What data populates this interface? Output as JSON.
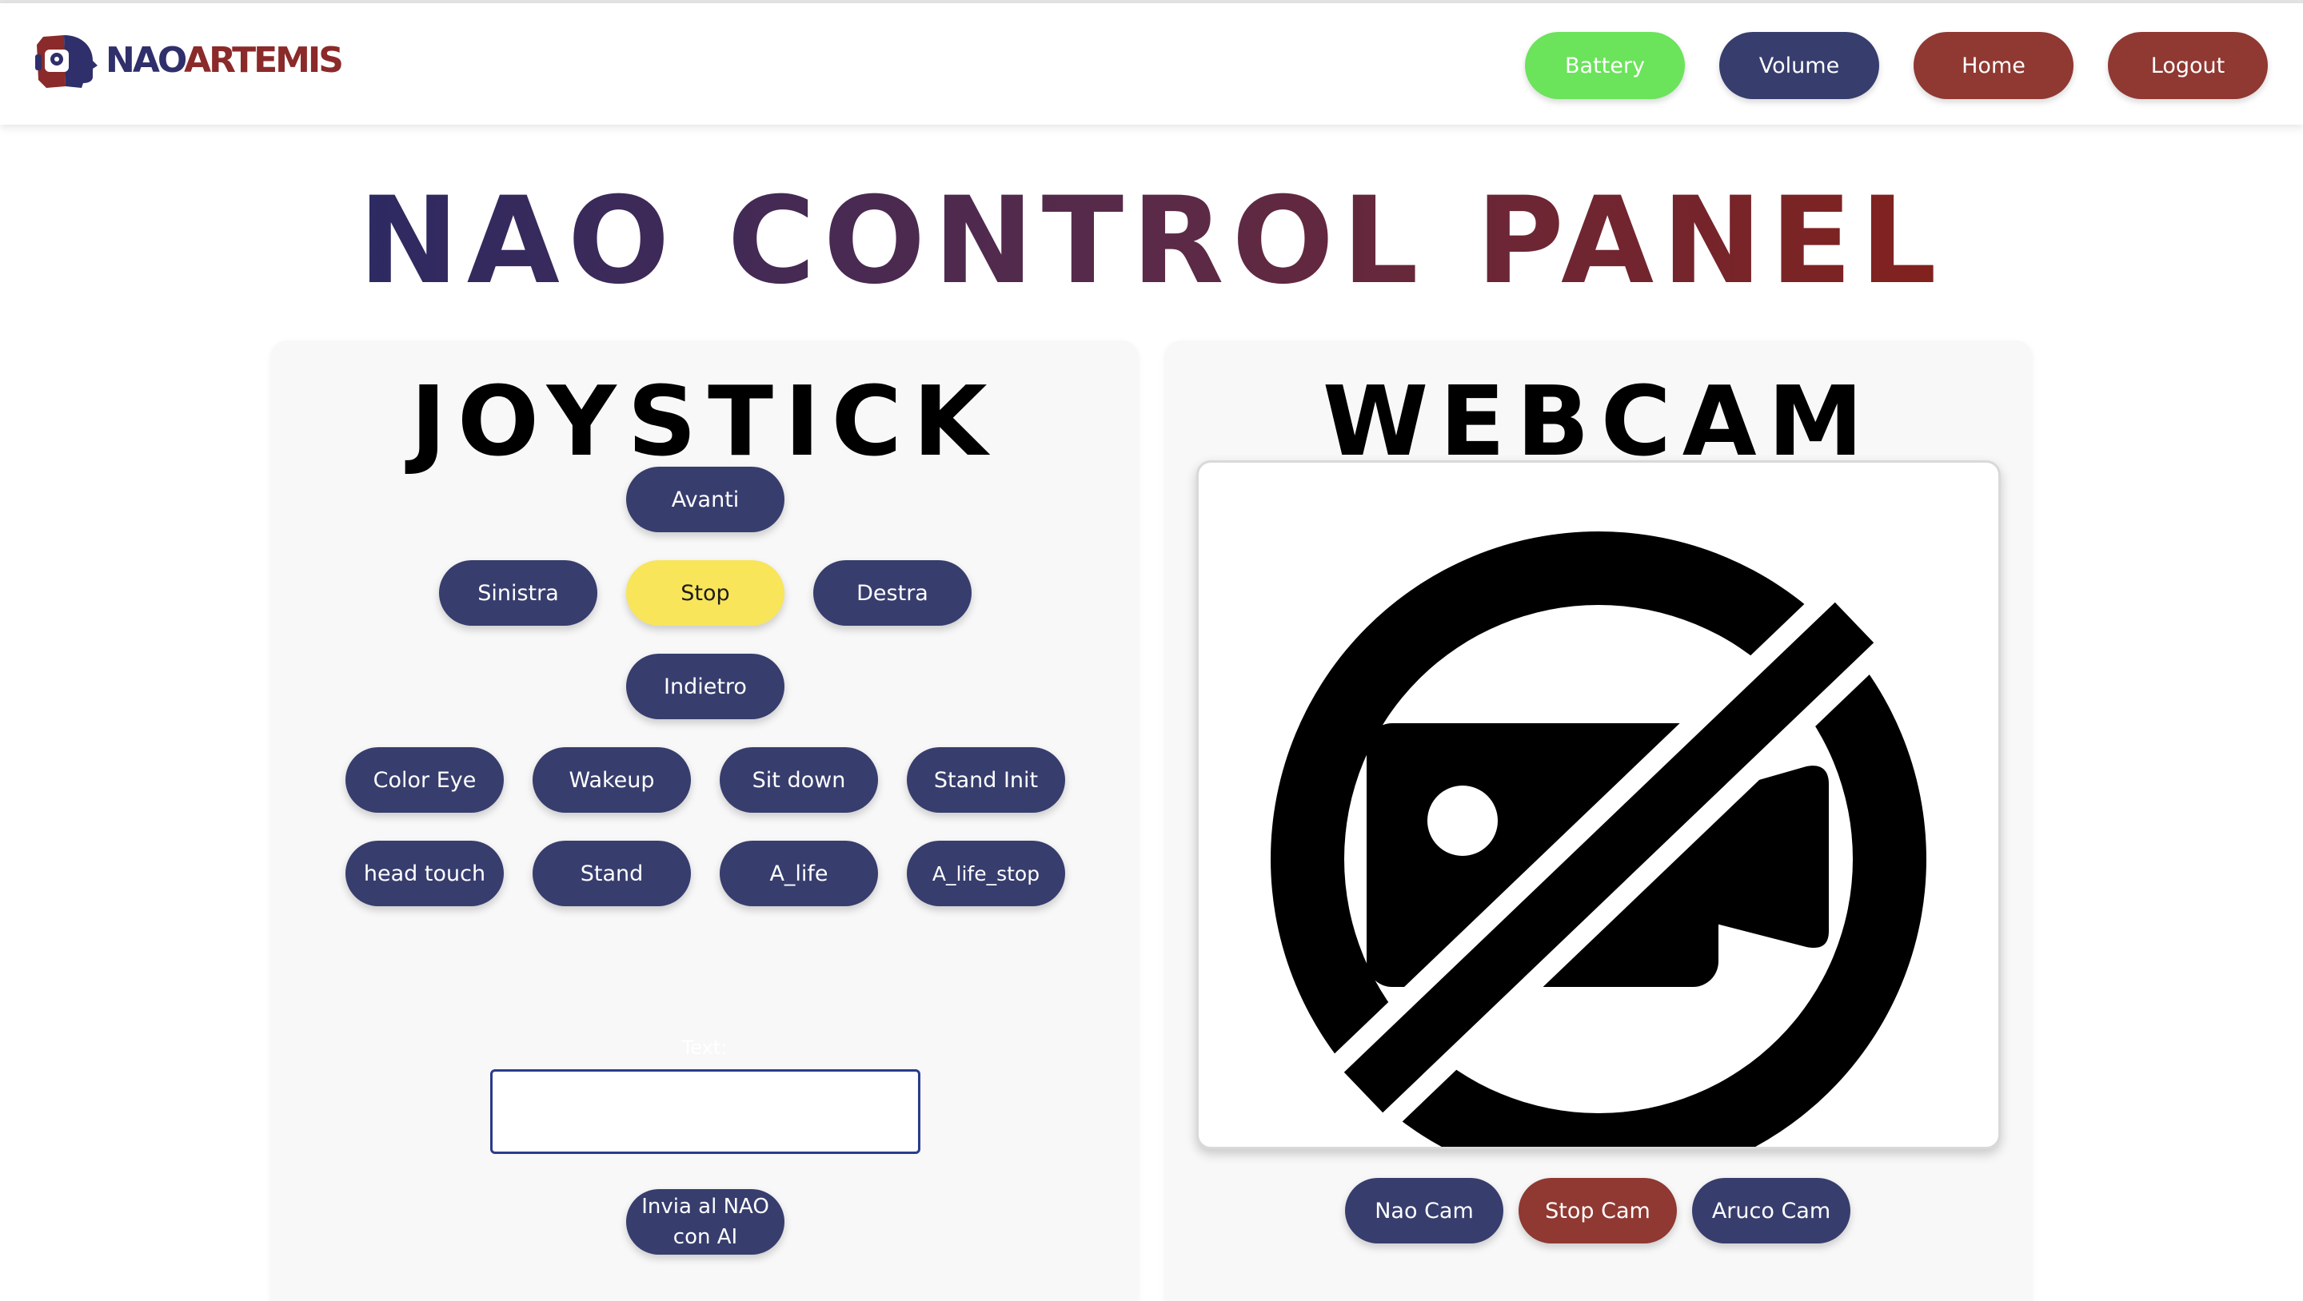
{
  "brand": {
    "logo_text_left": "NAO",
    "logo_text_right": "ARTEMIS"
  },
  "nav": {
    "battery": "Battery",
    "volume": "Volume",
    "home": "Home",
    "logout": "Logout"
  },
  "page_title": "NAO CONTROL PANEL",
  "joystick": {
    "title": "JOYSTICK",
    "avanti": "Avanti",
    "sinistra": "Sinistra",
    "stop": "Stop",
    "destra": "Destra",
    "indietro": "Indietro",
    "color_eye": "Color Eye",
    "wakeup": "Wakeup",
    "sit_down": "Sit down",
    "stand_init": "Stand Init",
    "head_touch": "head touch",
    "stand": "Stand",
    "a_life": "A_life",
    "a_life_stop": "A_life_stop",
    "text_label": "Text:",
    "text_value": "",
    "send_button": "Invia al NAO con AI"
  },
  "webcam": {
    "title": "WEBCAM",
    "nao_cam": "Nao Cam",
    "stop_cam": "Stop Cam",
    "aruco_cam": "Aruco Cam"
  },
  "icons": {
    "logo": "robot-head-logo-icon",
    "no_camera": "camera-off-icon"
  },
  "colors": {
    "navy": "#373d6d",
    "red": "#903832",
    "green": "#6be35b",
    "yellow": "#f8e55a"
  }
}
